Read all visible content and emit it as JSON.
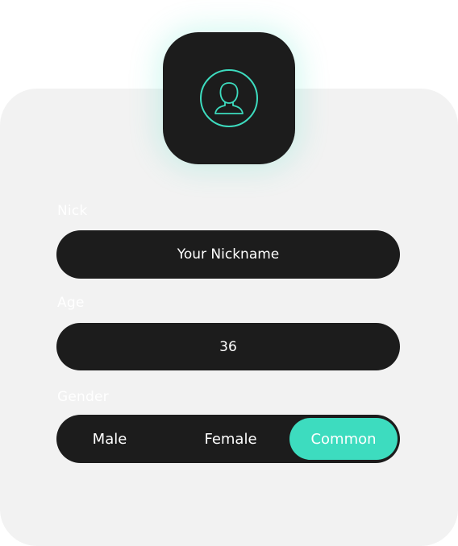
{
  "avatar": {
    "icon": "user-avatar-icon",
    "accent": "#3ddcbf"
  },
  "form": {
    "nick": {
      "label": "Nick",
      "value": "Your Nickname"
    },
    "age": {
      "label": "Age",
      "value": "36"
    },
    "gender": {
      "label": "Gender",
      "options": [
        "Male",
        "Female",
        "Common"
      ],
      "selected": "Common"
    }
  },
  "colors": {
    "card_bg": "#f2f2f2",
    "control_bg": "#1c1c1c",
    "accent": "#3ddcbf",
    "text": "#ffffff"
  }
}
